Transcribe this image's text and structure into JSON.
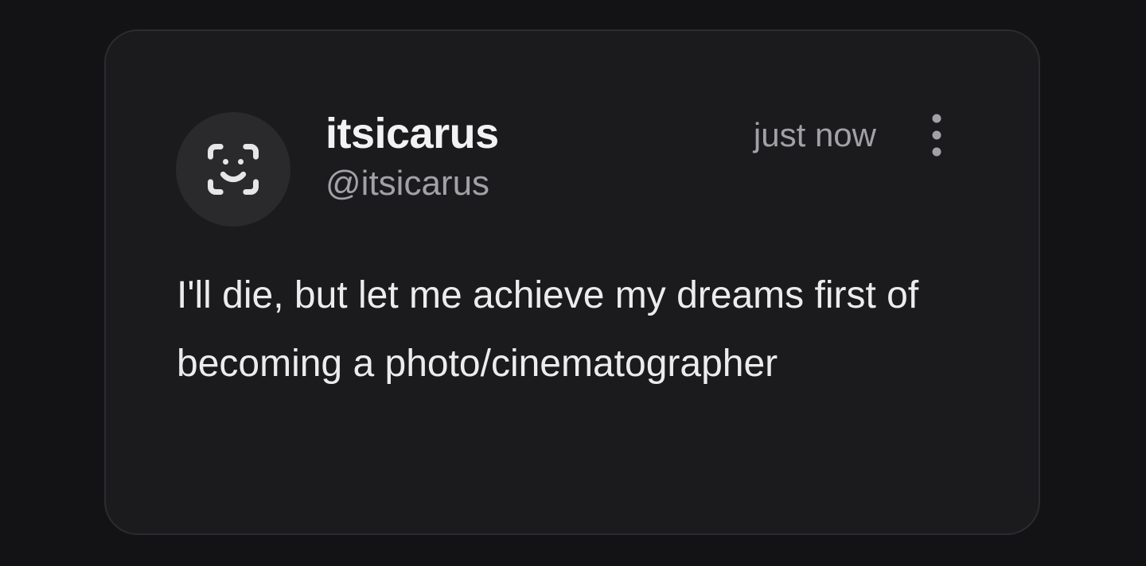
{
  "post": {
    "display_name": "itsicarus",
    "handle": "@itsicarus",
    "timestamp": "just now",
    "text": "I'll die, but let me achieve my dreams first of becoming a photo/cinematographer",
    "avatar_icon": "face-id-icon",
    "menu_icon": "more-vertical-icon"
  },
  "colors": {
    "page_background": "#131315",
    "card_background": "#1b1b1e",
    "card_border": "#2c2c30",
    "avatar_background": "#2a2a2d",
    "primary_text": "#f2f2f3",
    "secondary_text": "#a1a1a6"
  }
}
